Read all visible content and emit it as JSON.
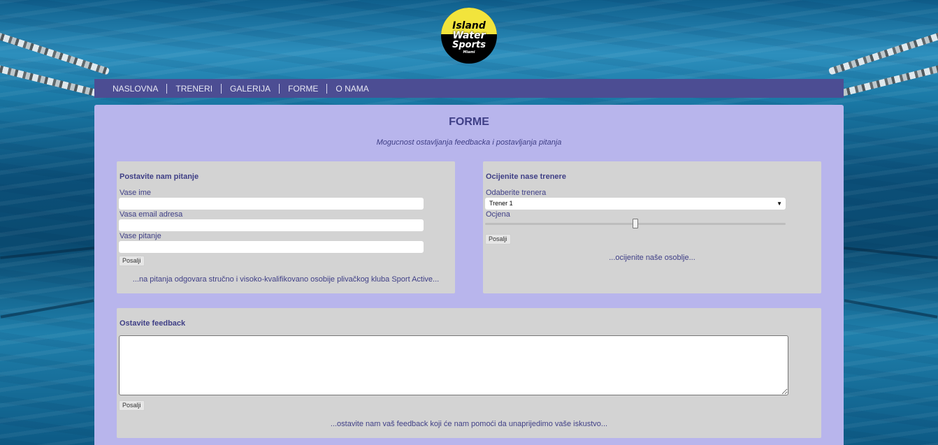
{
  "logo": {
    "lines": [
      "Island",
      "Water",
      "Sports",
      "Miami"
    ],
    "colors": {
      "sun": "#f2e43c",
      "badge": "#000000"
    }
  },
  "nav": {
    "items": [
      "NASLOVNA",
      "TRENERI",
      "GALERIJA",
      "FORME",
      "O NAMA"
    ],
    "background": "#4c4d93"
  },
  "main": {
    "title": "FORME",
    "subtitle": "Mogucnost ostavljanja feedbacka i postavljanja pitanja",
    "background": "#b8b5ec"
  },
  "question_form": {
    "title": "Postavite nam pitanje",
    "name_label": "Vase ime",
    "name_value": "",
    "email_label": "Vasa email adresa",
    "email_value": "",
    "question_label": "Vase pitanje",
    "question_value": "",
    "submit_label": "Posalji",
    "note": "...na pitanja odgovara stručno i visoko-kvalifikovano osobije plivačkog kluba Sport Active..."
  },
  "rating_form": {
    "title": "Ocijenite nase trenere",
    "trainer_label": "Odaberite trenera",
    "trainer_selected": "Trener 1",
    "rating_label": "Ocjena",
    "rating_value": 0.5,
    "submit_label": "Posalji",
    "note": "...ocijenite naše osoblje..."
  },
  "feedback_form": {
    "title": "Ostavite feedback",
    "feedback_value": "",
    "submit_label": "Posalji",
    "note": "...ostavite nam vaš feedback koji će nam pomoći da unaprijedimo vaše iskustvo..."
  }
}
